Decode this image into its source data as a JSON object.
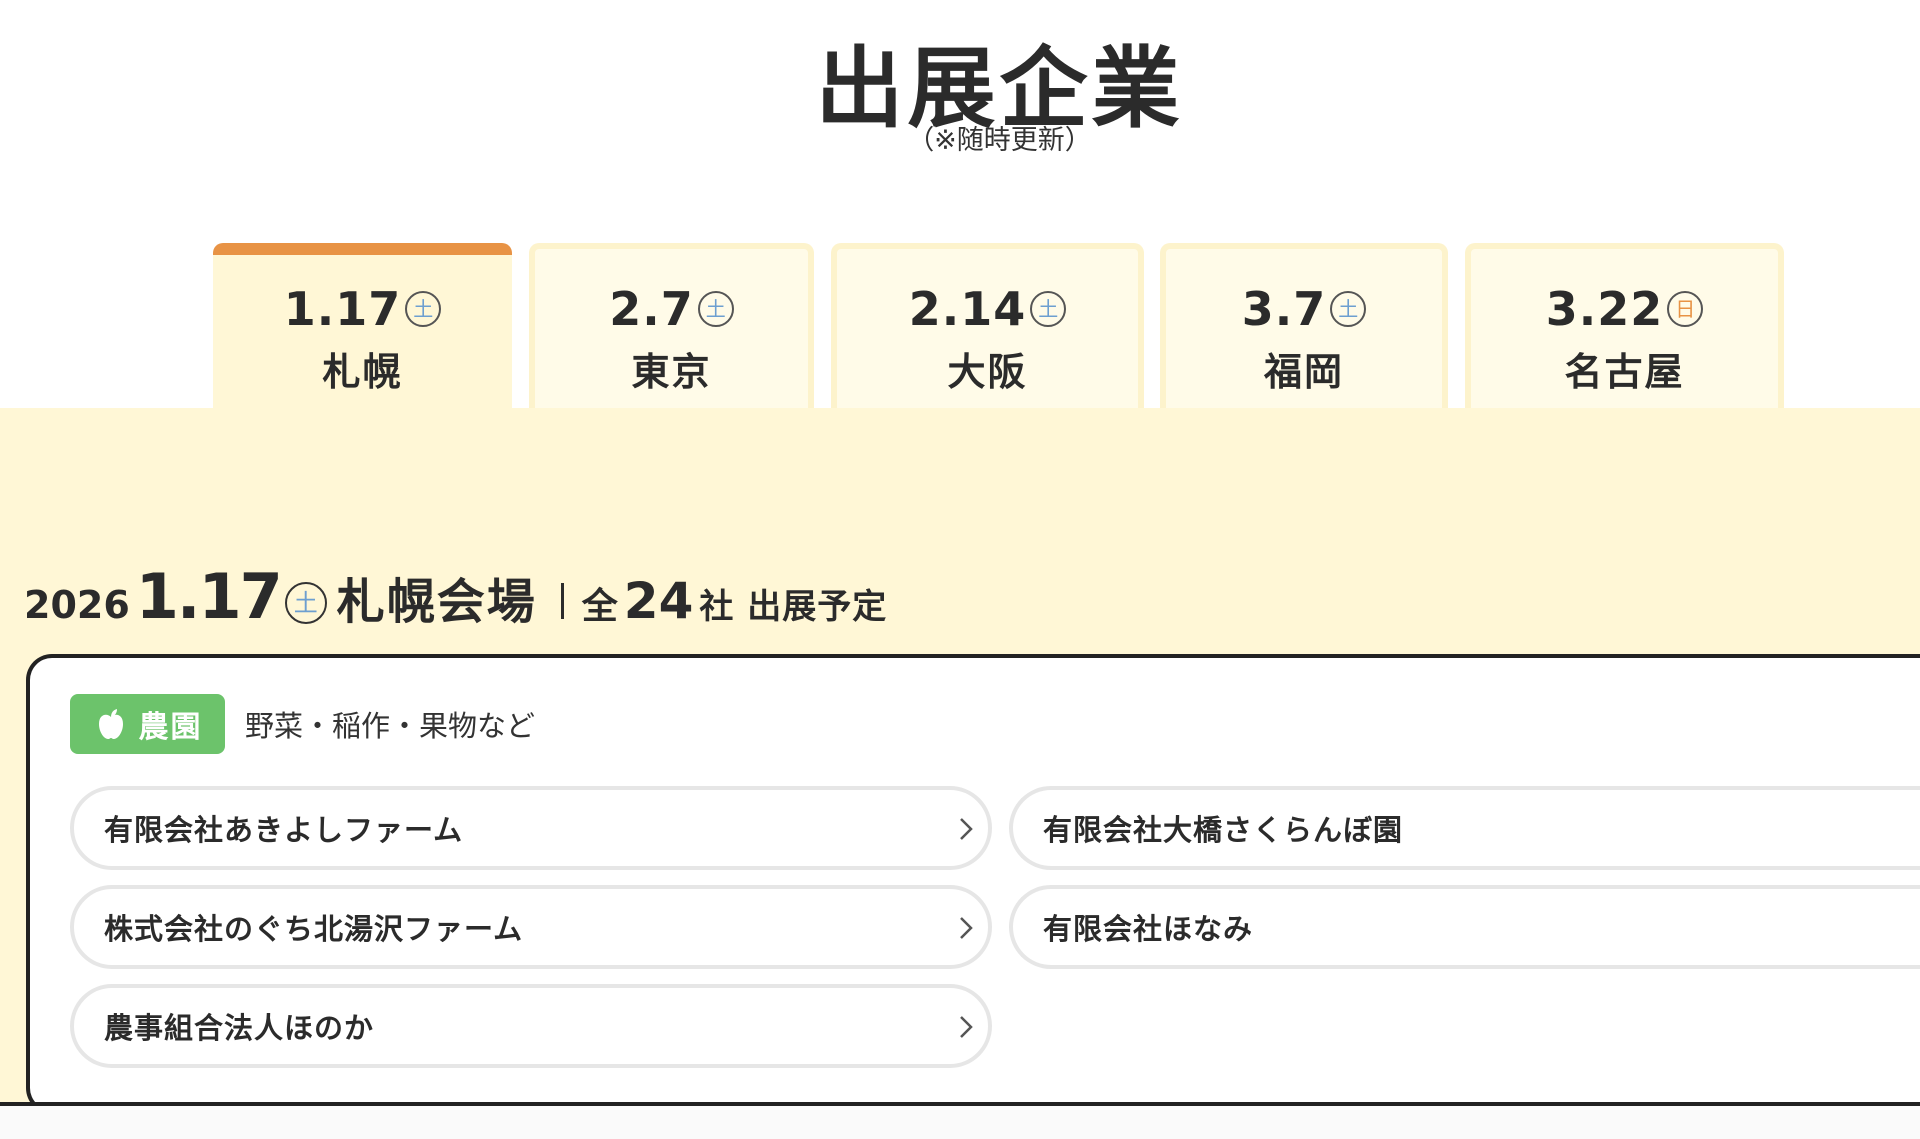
{
  "header": {
    "title": "出展企業",
    "subtitle": "（※随時更新）"
  },
  "tabs": [
    {
      "date": "1.17",
      "day": "土",
      "venue": "札幌",
      "active": true
    },
    {
      "date": "2.7",
      "day": "土",
      "venue": "東京",
      "active": false
    },
    {
      "date": "2.14",
      "day": "土",
      "venue": "大阪",
      "active": false
    },
    {
      "date": "3.7",
      "day": "土",
      "venue": "福岡",
      "active": false
    },
    {
      "date": "3.22",
      "day": "日",
      "venue": "名古屋",
      "active": false
    }
  ],
  "venue_heading": {
    "year": "2026",
    "date": "1.17",
    "day": "土",
    "venue": "札幌会場",
    "count_prefix": "全",
    "count": "24",
    "count_suffix": "社 出展予定"
  },
  "category": {
    "icon": "apple-icon",
    "label": "農園",
    "description": "野菜・稲作・果物など",
    "color": "#6cc36b"
  },
  "companies": [
    "有限会社あきよしファーム",
    "有限会社大橋さくらんぼ園",
    "株式会社のぐち北湯沢ファーム",
    "有限会社ほなみ",
    "農事組合法人ほのか"
  ],
  "colors": {
    "accent": "#e89345",
    "panel_bg": "#fff7d6",
    "weekday_blue": "#6d9fd0"
  }
}
